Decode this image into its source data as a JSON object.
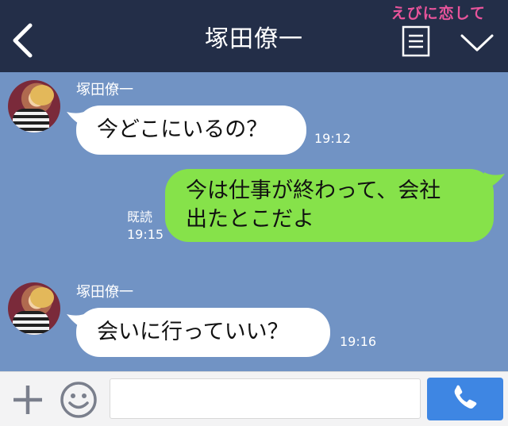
{
  "header": {
    "title": "塚田僚一",
    "watermark": "えびに恋して"
  },
  "messages": [
    {
      "sender": "塚田僚一",
      "text": "今どこにいるの？",
      "time": "19:12"
    },
    {
      "line1": "今は仕事が終わって、会社",
      "line2": "出たとこだよ",
      "read": "既読",
      "time": "19:15"
    },
    {
      "sender": "塚田僚一",
      "text": "会いに行っていい？",
      "time": "19:16"
    }
  ],
  "input": {
    "placeholder": "",
    "value": ""
  },
  "icons": {
    "back": "chevron-left-icon",
    "menu": "menu-list-icon",
    "collapse": "chevron-down-icon",
    "plus": "plus-icon",
    "emoji": "smiley-icon",
    "call": "phone-icon"
  },
  "colors": {
    "header": "#232e48",
    "background": "#7193c4",
    "incoming_bubble": "#ffffff",
    "outgoing_bubble": "#86e24a",
    "watermark": "#e8549b",
    "call_button": "#3e86e3"
  }
}
